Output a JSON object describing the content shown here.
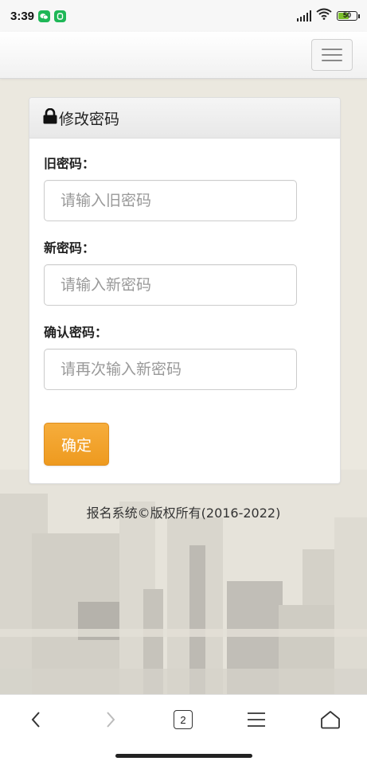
{
  "status_bar": {
    "time": "3:39",
    "battery": "50"
  },
  "panel": {
    "title": "修改密码"
  },
  "form": {
    "old_password": {
      "label": "旧密码：",
      "placeholder": "请输入旧密码"
    },
    "new_password": {
      "label": "新密码：",
      "placeholder": "请输入新密码"
    },
    "confirm_password": {
      "label": "确认密码：",
      "placeholder": "请再次输入新密码"
    },
    "submit_label": "确定"
  },
  "footer": {
    "text": "报名系统©版权所有(2016-2022)"
  },
  "browser_bar": {
    "tab_count": "2"
  },
  "icons": {
    "lock": "lock-icon",
    "menu": "hamburger-menu-icon",
    "back": "chevron-left-icon",
    "forward": "chevron-right-icon",
    "tabs": "tabs-icon",
    "browser_menu": "menu-icon",
    "home": "home-icon"
  },
  "colors": {
    "accent": "#f0a02a",
    "background": "#ebe8df"
  }
}
